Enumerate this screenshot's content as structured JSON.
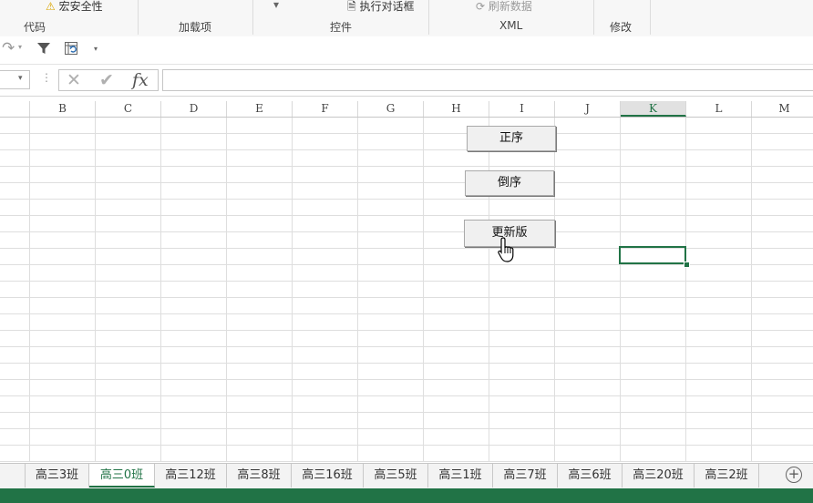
{
  "ribbon": {
    "items": {
      "macro_security": "宏安全性",
      "run_dialog": "执行对话框",
      "refresh_data": "刷新数据"
    },
    "groups": {
      "code": "代码",
      "addins": "加载项",
      "controls": "控件",
      "xml": "XML",
      "modify": "修改"
    }
  },
  "formula_bar": {
    "fx": "fx",
    "value": ""
  },
  "columns": [
    "B",
    "C",
    "D",
    "E",
    "F",
    "G",
    "H",
    "I",
    "J",
    "K",
    "L",
    "M"
  ],
  "selected_column": "K",
  "buttons": {
    "ascending": "正序",
    "descending": "倒序",
    "update": "更新版"
  },
  "tabs": [
    "高三3班",
    "高三0班",
    "高三12班",
    "高三8班",
    "高三16班",
    "高三5班",
    "高三1班",
    "高三7班",
    "高三6班",
    "高三20班",
    "高三2班"
  ],
  "active_tab": "高三0班",
  "colors": {
    "accent": "#217346"
  }
}
